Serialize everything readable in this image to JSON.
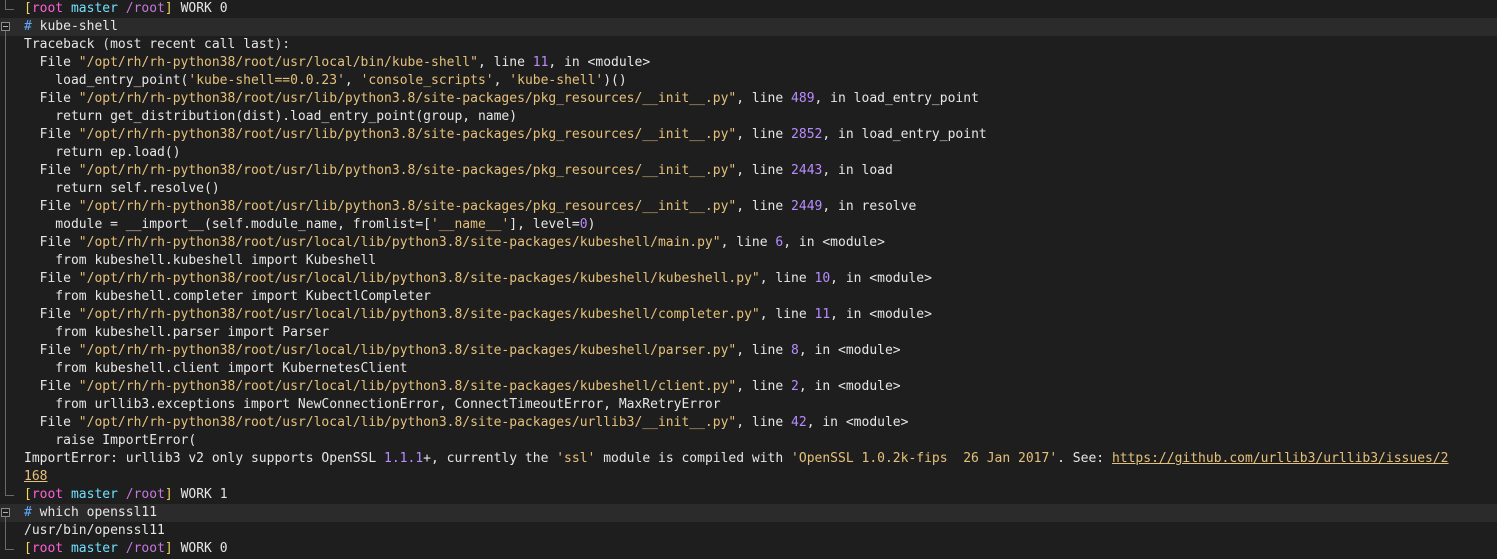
{
  "terminal": {
    "prompt": {
      "open": "[",
      "user": "root",
      "host": "master",
      "cwd": "/root",
      "close": "]",
      "work_label": "WORK"
    },
    "colors": {
      "background": "#1e1e1e",
      "highlight": "#2b2b2b",
      "string": "#e5c07b",
      "number": "#b98cff",
      "prompt_hash": "#5fa8ff"
    },
    "lines": [
      {
        "type": "prompt",
        "gutter": "corner",
        "status": "0"
      },
      {
        "type": "command",
        "gutter": "fold",
        "hash": "#",
        "cmd": "kube-shell"
      },
      {
        "type": "text",
        "gutter": "bar",
        "segments": [
          [
            "Traceback ",
            "c-plain"
          ],
          [
            "(",
            "c-op"
          ],
          [
            "most recent call last",
            "c-plain"
          ],
          [
            "):",
            "c-op"
          ]
        ]
      },
      {
        "type": "text",
        "gutter": "bar",
        "segments": [
          [
            "  File ",
            "c-plain"
          ],
          [
            "\"/opt/rh/rh-python38/root/usr/local/bin/kube-shell\"",
            "c-str"
          ],
          [
            ", line ",
            "c-plain"
          ],
          [
            "11",
            "c-num"
          ],
          [
            ", in <module>",
            "c-plain"
          ]
        ]
      },
      {
        "type": "text",
        "gutter": "bar",
        "segments": [
          [
            "    load_entry_point(",
            "c-plain"
          ],
          [
            "'kube-shell==0.0.23'",
            "c-str"
          ],
          [
            ", ",
            "c-plain"
          ],
          [
            "'console_scripts'",
            "c-str"
          ],
          [
            ", ",
            "c-plain"
          ],
          [
            "'kube-shell'",
            "c-str"
          ],
          [
            ")()",
            "c-plain"
          ]
        ]
      },
      {
        "type": "text",
        "gutter": "bar",
        "segments": [
          [
            "  File ",
            "c-plain"
          ],
          [
            "\"/opt/rh/rh-python38/root/usr/lib/python3.8/site-packages/pkg_resources/__init__.py\"",
            "c-str"
          ],
          [
            ", line ",
            "c-plain"
          ],
          [
            "489",
            "c-num"
          ],
          [
            ", in load_entry_point",
            "c-plain"
          ]
        ]
      },
      {
        "type": "text",
        "gutter": "bar",
        "segments": [
          [
            "    return get_distribution(dist).load_entry_point(group, name)",
            "c-plain"
          ]
        ]
      },
      {
        "type": "text",
        "gutter": "bar",
        "segments": [
          [
            "  File ",
            "c-plain"
          ],
          [
            "\"/opt/rh/rh-python38/root/usr/lib/python3.8/site-packages/pkg_resources/__init__.py\"",
            "c-str"
          ],
          [
            ", line ",
            "c-plain"
          ],
          [
            "2852",
            "c-num"
          ],
          [
            ", in load_entry_point",
            "c-plain"
          ]
        ]
      },
      {
        "type": "text",
        "gutter": "bar",
        "segments": [
          [
            "    return ep.load()",
            "c-plain"
          ]
        ]
      },
      {
        "type": "text",
        "gutter": "bar",
        "segments": [
          [
            "  File ",
            "c-plain"
          ],
          [
            "\"/opt/rh/rh-python38/root/usr/lib/python3.8/site-packages/pkg_resources/__init__.py\"",
            "c-str"
          ],
          [
            ", line ",
            "c-plain"
          ],
          [
            "2443",
            "c-num"
          ],
          [
            ", in load",
            "c-plain"
          ]
        ]
      },
      {
        "type": "text",
        "gutter": "bar",
        "segments": [
          [
            "    return self.resolve()",
            "c-plain"
          ]
        ]
      },
      {
        "type": "text",
        "gutter": "bar",
        "segments": [
          [
            "  File ",
            "c-plain"
          ],
          [
            "\"/opt/rh/rh-python38/root/usr/lib/python3.8/site-packages/pkg_resources/__init__.py\"",
            "c-str"
          ],
          [
            ", line ",
            "c-plain"
          ],
          [
            "2449",
            "c-num"
          ],
          [
            ", in resolve",
            "c-plain"
          ]
        ]
      },
      {
        "type": "text",
        "gutter": "bar",
        "segments": [
          [
            "    module = __import__(self.module_name, fromlist=[",
            "c-plain"
          ],
          [
            "'__name__'",
            "c-str"
          ],
          [
            "], level=",
            "c-plain"
          ],
          [
            "0",
            "c-num"
          ],
          [
            ")",
            "c-plain"
          ]
        ]
      },
      {
        "type": "text",
        "gutter": "bar",
        "segments": [
          [
            "  File ",
            "c-plain"
          ],
          [
            "\"/opt/rh/rh-python38/root/usr/local/lib/python3.8/site-packages/kubeshell/main.py\"",
            "c-str"
          ],
          [
            ", line ",
            "c-plain"
          ],
          [
            "6",
            "c-num"
          ],
          [
            ", in <module>",
            "c-plain"
          ]
        ]
      },
      {
        "type": "text",
        "gutter": "bar",
        "segments": [
          [
            "    from kubeshell.kubeshell import Kubeshell",
            "c-plain"
          ]
        ]
      },
      {
        "type": "text",
        "gutter": "bar",
        "segments": [
          [
            "  File ",
            "c-plain"
          ],
          [
            "\"/opt/rh/rh-python38/root/usr/local/lib/python3.8/site-packages/kubeshell/kubeshell.py\"",
            "c-str"
          ],
          [
            ", line ",
            "c-plain"
          ],
          [
            "10",
            "c-num"
          ],
          [
            ", in <module>",
            "c-plain"
          ]
        ]
      },
      {
        "type": "text",
        "gutter": "bar",
        "segments": [
          [
            "    from kubeshell.completer import KubectlCompleter",
            "c-plain"
          ]
        ]
      },
      {
        "type": "text",
        "gutter": "bar",
        "segments": [
          [
            "  File ",
            "c-plain"
          ],
          [
            "\"/opt/rh/rh-python38/root/usr/local/lib/python3.8/site-packages/kubeshell/completer.py\"",
            "c-str"
          ],
          [
            ", line ",
            "c-plain"
          ],
          [
            "11",
            "c-num"
          ],
          [
            ", in <module>",
            "c-plain"
          ]
        ]
      },
      {
        "type": "text",
        "gutter": "bar",
        "segments": [
          [
            "    from kubeshell.parser import Parser",
            "c-plain"
          ]
        ]
      },
      {
        "type": "text",
        "gutter": "bar",
        "segments": [
          [
            "  File ",
            "c-plain"
          ],
          [
            "\"/opt/rh/rh-python38/root/usr/local/lib/python3.8/site-packages/kubeshell/parser.py\"",
            "c-str"
          ],
          [
            ", line ",
            "c-plain"
          ],
          [
            "8",
            "c-num"
          ],
          [
            ", in <module>",
            "c-plain"
          ]
        ]
      },
      {
        "type": "text",
        "gutter": "bar",
        "segments": [
          [
            "    from kubeshell.client import KubernetesClient",
            "c-plain"
          ]
        ]
      },
      {
        "type": "text",
        "gutter": "bar",
        "segments": [
          [
            "  File ",
            "c-plain"
          ],
          [
            "\"/opt/rh/rh-python38/root/usr/local/lib/python3.8/site-packages/kubeshell/client.py\"",
            "c-str"
          ],
          [
            ", line ",
            "c-plain"
          ],
          [
            "2",
            "c-num"
          ],
          [
            ", in <module>",
            "c-plain"
          ]
        ]
      },
      {
        "type": "text",
        "gutter": "bar",
        "segments": [
          [
            "    from urllib3.exceptions import NewConnectionError, ConnectTimeoutError, MaxRetryError",
            "c-plain"
          ]
        ]
      },
      {
        "type": "text",
        "gutter": "bar",
        "segments": [
          [
            "  File ",
            "c-plain"
          ],
          [
            "\"/opt/rh/rh-python38/root/usr/local/lib/python3.8/site-packages/urllib3/__init__.py\"",
            "c-str"
          ],
          [
            ", line ",
            "c-plain"
          ],
          [
            "42",
            "c-num"
          ],
          [
            ", in <module>",
            "c-plain"
          ]
        ]
      },
      {
        "type": "text",
        "gutter": "bar",
        "segments": [
          [
            "    raise ImportError(",
            "c-plain"
          ]
        ]
      },
      {
        "type": "text",
        "gutter": "bar",
        "segments": [
          [
            "ImportError: urllib3 v2 only supports OpenSSL ",
            "c-plain"
          ],
          [
            "1.1.1",
            "c-num"
          ],
          [
            "+, currently the ",
            "c-plain"
          ],
          [
            "'ssl'",
            "c-str"
          ],
          [
            " module is compiled with ",
            "c-plain"
          ],
          [
            "'OpenSSL 1.0.2k-fips  26 Jan 2017'",
            "c-str"
          ],
          [
            ". See: ",
            "c-plain"
          ],
          [
            "https://github.com/urllib3/urllib3/issues/2",
            "c-link"
          ]
        ]
      },
      {
        "type": "text",
        "gutter": "bar",
        "segments": [
          [
            "168",
            "c-link"
          ]
        ]
      },
      {
        "type": "prompt",
        "gutter": "corner",
        "status": "1"
      },
      {
        "type": "command",
        "gutter": "fold",
        "hash": "#",
        "cmd": "which openssl11"
      },
      {
        "type": "text",
        "gutter": "bar",
        "segments": [
          [
            "/usr/bin/openssl11",
            "c-plain"
          ]
        ]
      },
      {
        "type": "prompt",
        "gutter": "corner",
        "status": "0"
      }
    ]
  }
}
